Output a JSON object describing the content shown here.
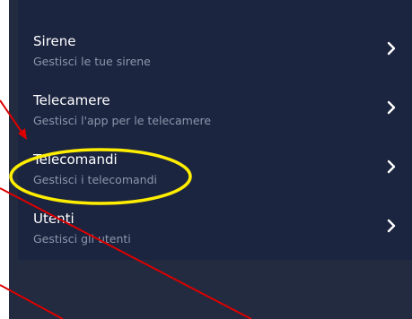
{
  "menu": {
    "items": [
      {
        "title": "Sirene",
        "subtitle": "Gestisci le tue sirene",
        "icon": "chevron-right-icon"
      },
      {
        "title": "Telecamere",
        "subtitle": "Gestisci l'app per le telecamere",
        "icon": "chevron-right-icon"
      },
      {
        "title": "Telecomandi",
        "subtitle": "Gestisci i telecomandi",
        "icon": "chevron-right-icon"
      },
      {
        "title": "Utenti",
        "subtitle": "Gestisci gli utenti",
        "icon": "chevron-right-icon"
      }
    ]
  },
  "annotations": {
    "highlight_color": "#ffee00",
    "line_color": "#dd0000"
  },
  "colors": {
    "background": "#222b40",
    "panel": "#1c2540",
    "title_text": "#ffffff",
    "subtitle_text": "#8d96ab"
  }
}
